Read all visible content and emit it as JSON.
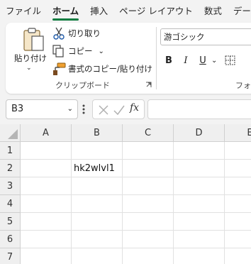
{
  "menu": {
    "tabs": [
      "ファイル",
      "ホーム",
      "挿入",
      "ページ レイアウト",
      "数式",
      "データ"
    ],
    "active_index": 1
  },
  "ribbon": {
    "clipboard": {
      "paste_label": "貼り付け",
      "cut_label": "切り取り",
      "copy_label": "コピー",
      "format_painter_label": "書式のコピー/貼り付け",
      "group_label": "クリップボード"
    },
    "font": {
      "font_name": "游ゴシック",
      "bold": "B",
      "italic": "I",
      "underline": "U",
      "group_label_partial": "フォン"
    }
  },
  "formula_bar": {
    "name_box": "B3",
    "fx": "fx",
    "formula": ""
  },
  "sheet": {
    "columns": [
      "A",
      "B",
      "C",
      "D",
      "E"
    ],
    "rows": [
      "1",
      "2",
      "3",
      "4",
      "5",
      "6",
      "7"
    ],
    "cells": {
      "B2": "hk2wlvl1"
    }
  },
  "colors": {
    "accent": "#107c41",
    "header_bg": "#efefef",
    "grid_line": "#e1e1e1"
  }
}
